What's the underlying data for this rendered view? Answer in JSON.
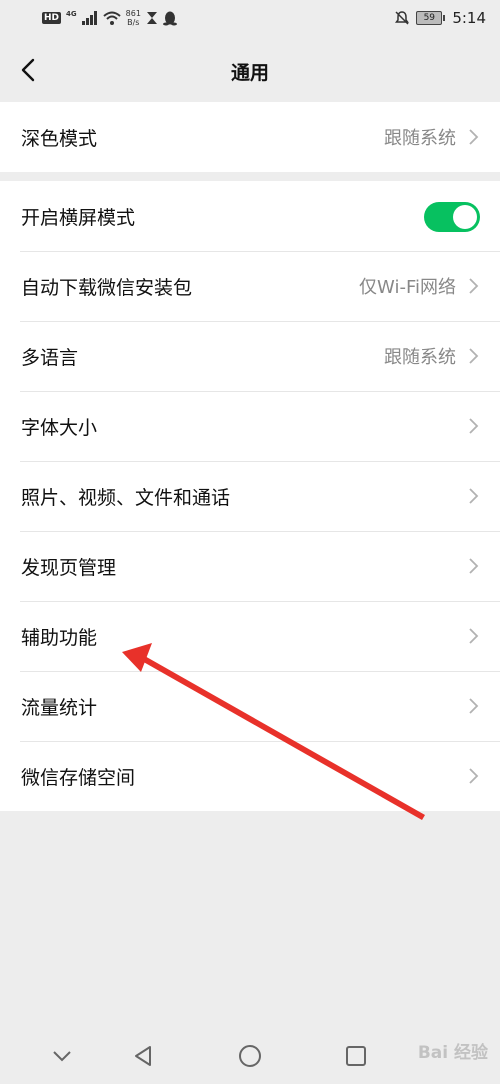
{
  "status_bar": {
    "hd": "HD",
    "network": "4G",
    "speed_value": "861",
    "speed_unit": "B/s",
    "battery": "59",
    "time": "5:14"
  },
  "nav": {
    "title": "通用"
  },
  "groups": [
    {
      "rows": [
        {
          "label": "深色模式",
          "value": "跟随系统"
        }
      ]
    },
    {
      "rows": [
        {
          "label": "开启横屏模式",
          "toggle_on": true
        },
        {
          "label": "自动下载微信安装包",
          "value": "仅Wi-Fi网络"
        },
        {
          "label": "多语言",
          "value": "跟随系统"
        },
        {
          "label": "字体大小"
        },
        {
          "label": "照片、视频、文件和通话"
        },
        {
          "label": "发现页管理"
        },
        {
          "label": "辅助功能"
        },
        {
          "label": "流量统计"
        },
        {
          "label": "微信存储空间"
        }
      ]
    }
  ],
  "annotation": {
    "arrow_color": "#e8312a"
  },
  "accent": {
    "toggle_on": "#07c160"
  },
  "watermark": "Bai 经验"
}
